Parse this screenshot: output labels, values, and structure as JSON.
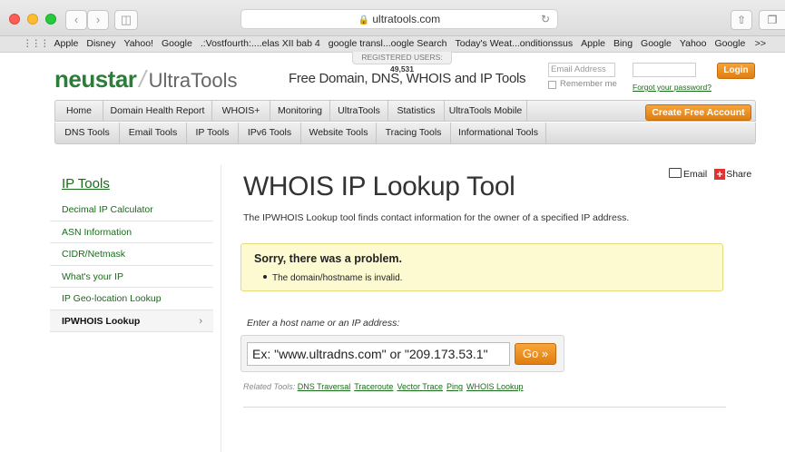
{
  "browser": {
    "url": "ultratools.com",
    "bookmarks": [
      "Apple",
      "Disney",
      "Yahoo!",
      "Google",
      ".:Vostfourth:....elas XII bab 4",
      "google transl...oogle Search",
      "Today's Weat...onditionssus",
      "Apple",
      "Bing",
      "Google",
      "Yahoo",
      "Google"
    ],
    "more": ">>"
  },
  "header": {
    "logo_brand": "neustar",
    "logo_sep": "/",
    "logo_product": "UltraTools",
    "tagline": "Free Domain, DNS, WHOIS and IP Tools",
    "registered_label": "REGISTERED USERS:",
    "registered_count": "49,531",
    "email_placeholder": "Email Address",
    "remember_label": "Remember me",
    "forgot_label": "Forgot your password?",
    "login_label": "Login",
    "create_account_label": "Create Free Account"
  },
  "nav_primary": [
    "Home",
    "Domain Health Report",
    "WHOIS+",
    "Monitoring",
    "UltraTools",
    "Statistics",
    "UltraTools Mobile"
  ],
  "nav_secondary": [
    "DNS Tools",
    "Email Tools",
    "IP Tools",
    "IPv6 Tools",
    "Website Tools",
    "Tracing Tools",
    "Informational Tools"
  ],
  "sidebar": {
    "title": "IP Tools",
    "items": [
      {
        "label": "Decimal IP Calculator"
      },
      {
        "label": "ASN Information"
      },
      {
        "label": "CIDR/Netmask"
      },
      {
        "label": "What's your IP"
      },
      {
        "label": "IP Geo-location Lookup"
      },
      {
        "label": "IPWHOIS Lookup",
        "active": true
      }
    ],
    "active_chevron": "›"
  },
  "main": {
    "email_label": "Email",
    "share_label": "Share",
    "title": "WHOIS IP Lookup Tool",
    "description": "The IPWHOIS Lookup tool finds contact information for the owner of a specified IP address.",
    "error_title": "Sorry, there was a problem.",
    "error_item": "The domain/hostname is invalid.",
    "prompt": "Enter a host name or an IP address:",
    "input_placeholder": "Ex: \"www.ultradns.com\" or \"209.173.53.1\"",
    "go_label": "Go »",
    "related_label": "Related Tools:",
    "related_links": [
      "DNS Traversal",
      "Traceroute",
      "Vector Trace",
      "Ping",
      "WHOIS Lookup"
    ]
  },
  "colors": {
    "brand_green": "#2d7d3a",
    "accent_orange": "#e88a1a",
    "error_bg": "#fdfad2"
  }
}
